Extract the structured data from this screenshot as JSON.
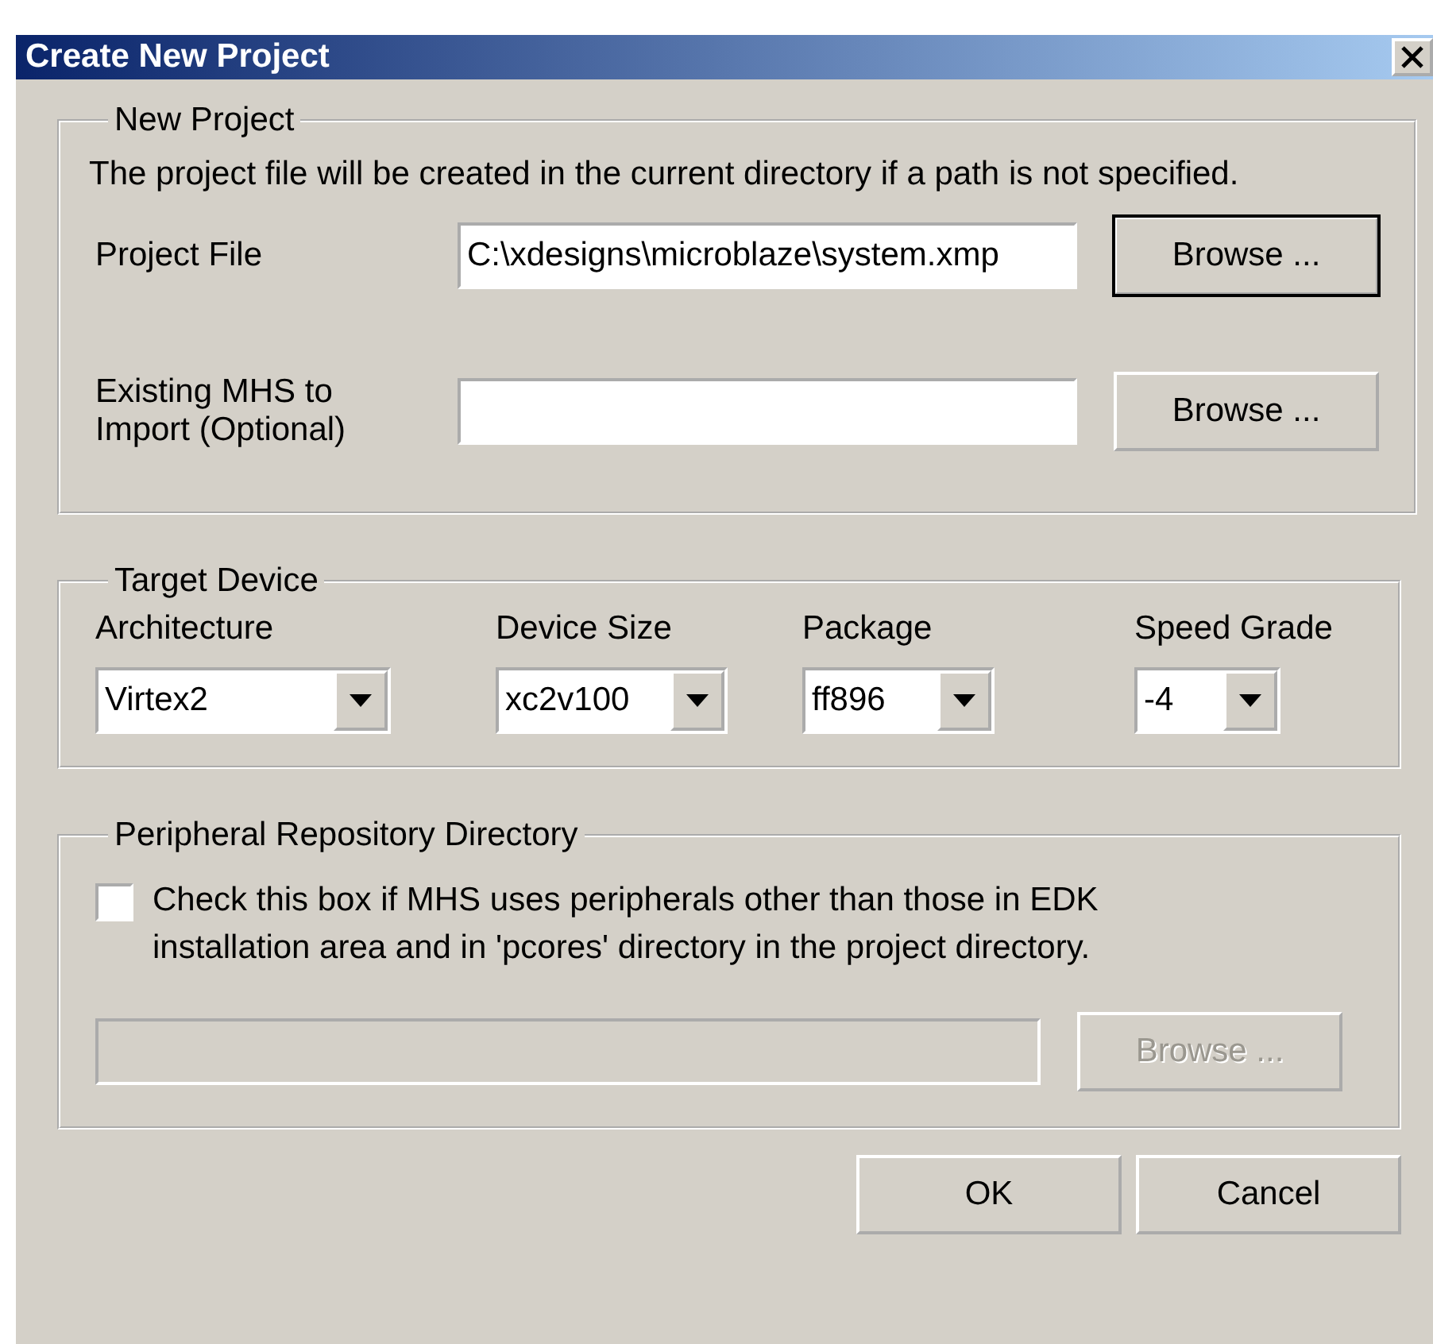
{
  "window": {
    "title": "Create New Project"
  },
  "new_project": {
    "title": "New Project",
    "note": "The project file will be created in the current directory if a path is not specified.",
    "fields": [
      {
        "label": "Project File",
        "value": "C:\\xdesigns\\microblaze\\system.xmp",
        "button": {
          "label": "Browse ...",
          "default": true
        }
      },
      {
        "label": "Existing MHS to Import (Optional)",
        "button": {
          "label": "Browse ...",
          "default": false
        }
      }
    ]
  },
  "target_device": {
    "title": "Target Device",
    "dropdowns": [
      {
        "label": "Architecture",
        "value": "Virtex2"
      },
      {
        "label": "Device Size",
        "value": "xc2v100"
      },
      {
        "label": "Package",
        "value": "ff896"
      },
      {
        "label": "Speed Grade",
        "value": "-4"
      }
    ]
  },
  "peripheral_repository": {
    "title": "Peripheral Repository Directory",
    "checkbox": {
      "label": "Check this box if MHS uses peripherals other than those in EDK installation area and in 'pcores' directory in the project directory.",
      "checked": false
    },
    "path_field": {
      "disabled": true
    },
    "button": {
      "label": "Browse ...",
      "disabled": true
    }
  },
  "buttons": [
    {
      "label": "OK"
    },
    {
      "label": "Cancel"
    }
  ]
}
